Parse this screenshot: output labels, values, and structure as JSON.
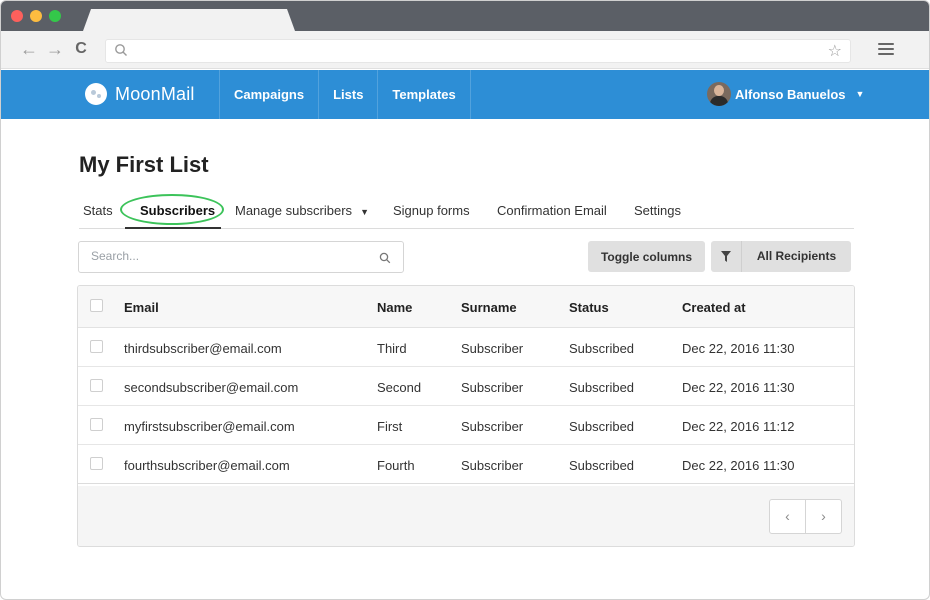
{
  "browser": {
    "nav_back": "←",
    "nav_forward": "→",
    "nav_reload": "C",
    "address_value": "",
    "star": "☆"
  },
  "app": {
    "brand": "MoonMail",
    "nav": [
      {
        "label": "Campaigns"
      },
      {
        "label": "Lists"
      },
      {
        "label": "Templates"
      }
    ],
    "user_name": "Alfonso Banuelos",
    "accent_color": "#2d8ed6"
  },
  "page": {
    "title": "My First List",
    "tabs": [
      {
        "label": "Stats"
      },
      {
        "label": "Subscribers",
        "active": true
      },
      {
        "label": "Manage subscribers"
      },
      {
        "label": "Signup forms"
      },
      {
        "label": "Confirmation Email"
      },
      {
        "label": "Settings"
      }
    ],
    "search_placeholder": "Search...",
    "toggle_columns_label": "Toggle columns",
    "filter_label": "All Recipients",
    "highlight_color": "#3cc35a"
  },
  "table": {
    "columns": [
      "Email",
      "Name",
      "Surname",
      "Status",
      "Created at"
    ],
    "rows": [
      {
        "email": "thirdsubscriber@email.com",
        "name": "Third",
        "surname": "Subscriber",
        "status": "Subscribed",
        "created": "Dec 22, 2016 11:30"
      },
      {
        "email": "secondsubscriber@email.com",
        "name": "Second",
        "surname": "Subscriber",
        "status": "Subscribed",
        "created": "Dec 22, 2016 11:30"
      },
      {
        "email": "myfirstsubscriber@email.com",
        "name": "First",
        "surname": "Subscriber",
        "status": "Subscribed",
        "created": "Dec 22, 2016 11:12"
      },
      {
        "email": "fourthsubscriber@email.com",
        "name": "Fourth",
        "surname": "Subscriber",
        "status": "Subscribed",
        "created": "Dec 22, 2016 11:30"
      }
    ],
    "pager_prev": "‹",
    "pager_next": "›"
  }
}
